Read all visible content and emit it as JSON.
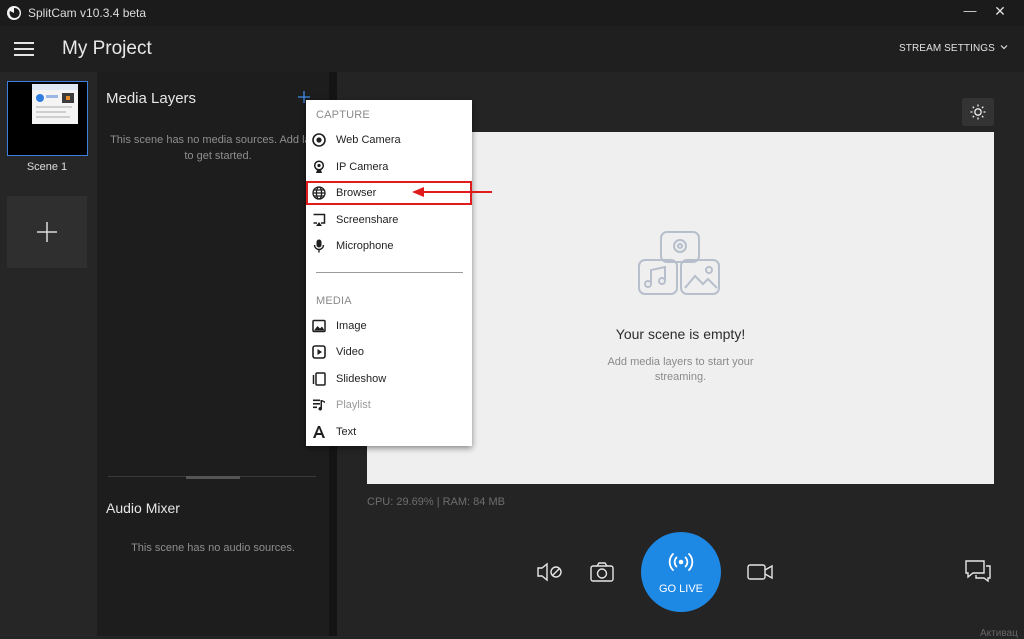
{
  "window": {
    "title": "SplitCam v10.3.4 beta",
    "minimize": "—",
    "close": "✕"
  },
  "header": {
    "project_title": "My Project",
    "stream_settings": "STREAM SETTINGS"
  },
  "scenes": [
    {
      "label": "Scene 1"
    }
  ],
  "layers_panel": {
    "title": "Media Layers",
    "empty_text": "This scene has no media sources. Add layer to get started."
  },
  "audio_mixer": {
    "title": "Audio Mixer",
    "empty_text": "This scene has no audio sources."
  },
  "add_menu": {
    "capture_label": "CAPTURE",
    "media_label": "MEDIA",
    "capture_items": [
      {
        "label": "Web Camera",
        "icon": "webcam-icon"
      },
      {
        "label": "IP Camera",
        "icon": "ip-camera-icon"
      },
      {
        "label": "Browser",
        "icon": "globe-icon",
        "highlighted": true
      },
      {
        "label": "Screenshare",
        "icon": "screenshare-icon"
      },
      {
        "label": "Microphone",
        "icon": "microphone-icon"
      }
    ],
    "media_items": [
      {
        "label": "Image",
        "icon": "image-icon"
      },
      {
        "label": "Video",
        "icon": "video-icon"
      },
      {
        "label": "Slideshow",
        "icon": "slideshow-icon"
      },
      {
        "label": "Playlist",
        "icon": "playlist-icon",
        "disabled": true
      },
      {
        "label": "Text",
        "icon": "text-icon"
      }
    ]
  },
  "canvas": {
    "empty_title": "Your scene is empty!",
    "empty_subtitle": "Add media layers to start your streaming."
  },
  "stats": {
    "text": "CPU: 29.69% | RAM: 84 MB"
  },
  "controls": {
    "go_live": "GO LIVE"
  },
  "footer": {
    "activation_hint": "Активац"
  },
  "colors": {
    "accent": "#1e88e5",
    "highlight": "#e01b1b",
    "selection": "#3d7fe0"
  }
}
